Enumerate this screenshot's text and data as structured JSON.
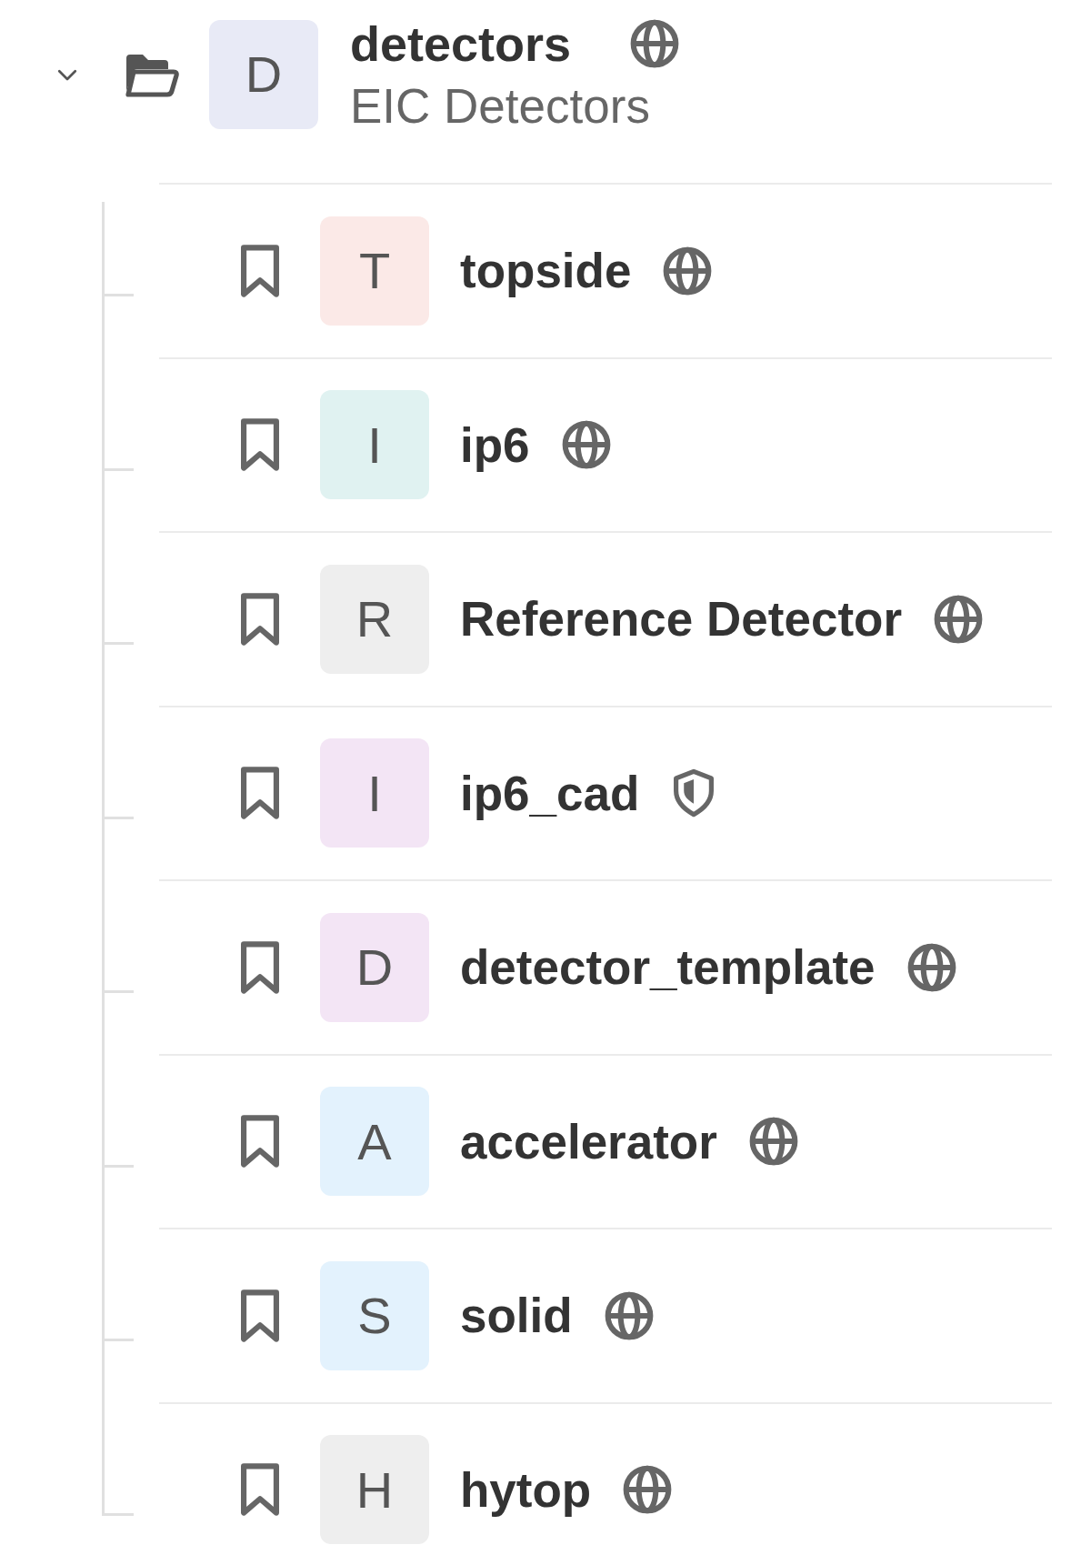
{
  "tree": {
    "name": "detectors",
    "description": "EIC Detectors",
    "initial": "D",
    "color": "#e8eaf6",
    "kind": "public",
    "expanded": true,
    "children": [
      {
        "name": "topside",
        "initial": "T",
        "color": "#fbe9e7",
        "kind": "public"
      },
      {
        "name": "ip6",
        "initial": "I",
        "color": "#e0f2f1",
        "kind": "public"
      },
      {
        "name": "Reference Detector",
        "initial": "R",
        "color": "#eeeeee",
        "kind": "public"
      },
      {
        "name": "ip6_cad",
        "initial": "I",
        "color": "#f3e5f5",
        "kind": "private"
      },
      {
        "name": "detector_template",
        "initial": "D",
        "color": "#f3e5f5",
        "kind": "public"
      },
      {
        "name": "accelerator",
        "initial": "A",
        "color": "#e3f2fd",
        "kind": "public"
      },
      {
        "name": "solid",
        "initial": "S",
        "color": "#e3f2fd",
        "kind": "public"
      },
      {
        "name": "hytop",
        "initial": "H",
        "color": "#eeeeee",
        "kind": "public"
      }
    ]
  }
}
